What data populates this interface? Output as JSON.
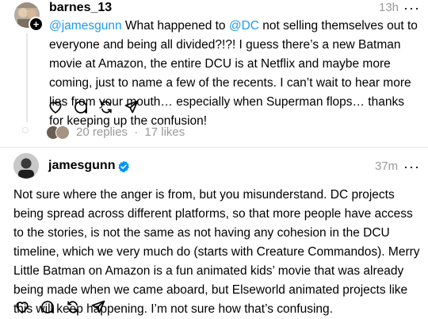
{
  "post1": {
    "username": "barnes_13",
    "time": "13h",
    "mention1": "@jamesgunn",
    "text_part1": " What happened to ",
    "mention2": "@DC",
    "text_part2": " not selling themselves out to everyone and being all divided?!?! I guess there’s a new Batman movie at Amazon, the entire DCU is at Netflix and maybe more coming, just to name a few of the recents. I can’t wait to hear more lies from your mouth… especially when Superman flops… thanks for keeping up the confusion!",
    "replies": "20 replies",
    "separator": "·",
    "likes": "17 likes",
    "follow_badge": "+"
  },
  "post2": {
    "username": "jamesgunn",
    "time": "37m",
    "text": "Not sure where the anger is from, but you misunderstand. DC projects being spread across different platforms, so that more people have access to the stories, is not the same as not having any cohesion in the DCU timeline, which we very much do (starts with Creature Commandos). Merry Little Batman on Amazon is a fun animated kids’ movie that was already being made when we came aboard, but Elseworld animated projects like this will keep happening. I’m not sure how that’s confusing."
  },
  "more_label": "···",
  "colors": {
    "link": "#1d9bf0",
    "muted": "#999999",
    "verified": "#0095f6"
  },
  "icons": [
    "heart-icon",
    "comment-icon",
    "repost-icon",
    "share-icon",
    "verified-icon",
    "more-icon"
  ]
}
